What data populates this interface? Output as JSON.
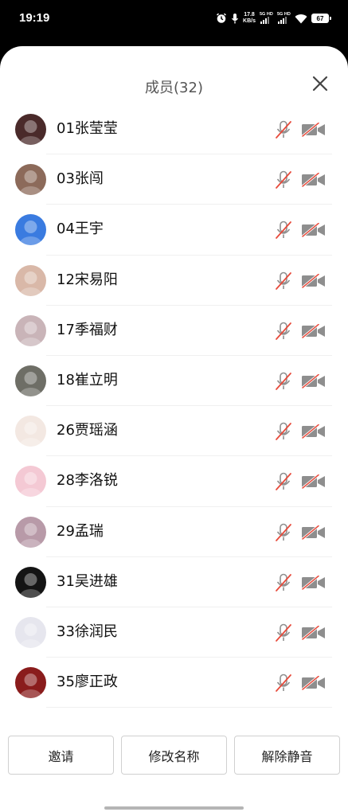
{
  "status_bar": {
    "time": "19:19",
    "speed_value": "17.8",
    "speed_unit": "KB/s",
    "net1": "5G HD",
    "net2": "5G HD",
    "battery": "67",
    "icons": [
      "alarm-icon",
      "mic-icon",
      "wifi-icon"
    ]
  },
  "sheet": {
    "title": "成员(32)",
    "close_icon": "close-icon"
  },
  "members": [
    {
      "name": "01张莹莹",
      "avatar_color": "#4a2a2a"
    },
    {
      "name": "03张闯",
      "avatar_color": "#8c6a5a"
    },
    {
      "name": "04王宇",
      "avatar_color": "#3a7be0"
    },
    {
      "name": "12宋易阳",
      "avatar_color": "#d9b8a8"
    },
    {
      "name": "17季福财",
      "avatar_color": "#c9b4b8"
    },
    {
      "name": "18崔立明",
      "avatar_color": "#6e6e66"
    },
    {
      "name": "26贾瑶涵",
      "avatar_color": "#f3e8e2"
    },
    {
      "name": "28李洛锐",
      "avatar_color": "#f4c9d4"
    },
    {
      "name": "29孟瑞",
      "avatar_color": "#b89aa8"
    },
    {
      "name": "31吴进雄",
      "avatar_color": "#141414"
    },
    {
      "name": "33徐润民",
      "avatar_color": "#e6e6ee"
    },
    {
      "name": "35廖正政",
      "avatar_color": "#8a1c1c"
    }
  ],
  "member_icons": {
    "mic": "mic-muted-icon",
    "camera": "camera-off-icon"
  },
  "footer": {
    "invite": "邀请",
    "rename": "修改名称",
    "unmute": "解除静音"
  },
  "colors": {
    "mute_red": "#e84b3c",
    "icon_gray": "#8e8e8e"
  }
}
